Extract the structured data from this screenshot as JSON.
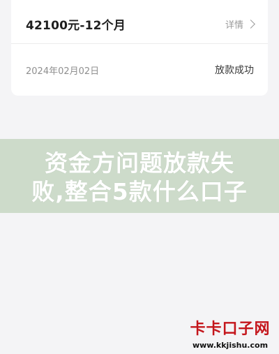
{
  "loan_card": {
    "amount_term": "42100元-12个月",
    "detail_label": "详情",
    "date": "2024年02月02日",
    "status": "放款成功"
  },
  "overlay": {
    "line1": "资金方问题放款失",
    "line2": "败,整合5款什么口子"
  },
  "watermark": {
    "title": "卡卡口子网",
    "url": "www.kkjishu.com"
  },
  "colors": {
    "background": "#f4f4f6",
    "card": "#ffffff",
    "banner": "#c9d8c6",
    "watermark_red": "#c4161c"
  },
  "icons": [
    "chevron-right-icon"
  ]
}
